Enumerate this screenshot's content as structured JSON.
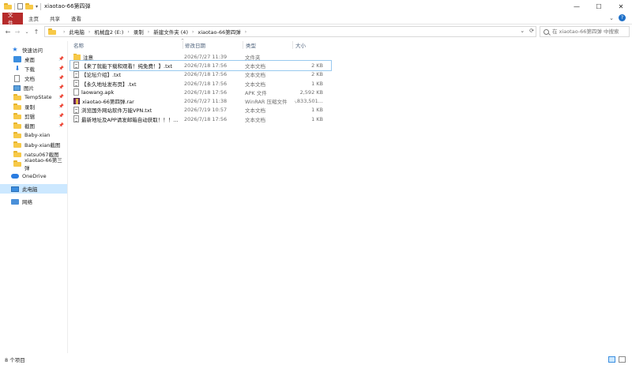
{
  "window": {
    "title": "xiaotao-66第四弹",
    "minimize_glyph": "—",
    "maximize_glyph": "☐",
    "close_glyph": "✕"
  },
  "ribbon": {
    "tabs": [
      "文件",
      "主页",
      "共享",
      "查看"
    ],
    "collapse_glyph": "⌄",
    "help_glyph": "?"
  },
  "navigation": {
    "back_glyph": "←",
    "forward_glyph": "→",
    "recent_glyph": "⌄",
    "up_glyph": "↑",
    "breadcrumb": [
      "此电脑",
      "机械盘2 (E:)",
      "录制",
      "新建文件夹 (4)",
      "xiaotao-66第四弹"
    ],
    "crumb_separator": "›",
    "dropdown_glyph": "⌄",
    "refresh_glyph": "⟳"
  },
  "search": {
    "placeholder": "在 xiaotao-66第四弹 中搜索"
  },
  "sidebar": {
    "items": [
      {
        "label": "快速访问",
        "icon": "star-icon",
        "pinned": false
      },
      {
        "label": "桌面",
        "icon": "desktop-icon",
        "pinned": true
      },
      {
        "label": "下载",
        "icon": "download-icon",
        "pinned": true
      },
      {
        "label": "文档",
        "icon": "document-icon",
        "pinned": true
      },
      {
        "label": "图片",
        "icon": "pictures-icon",
        "pinned": true
      },
      {
        "label": "TempState",
        "icon": "folder-icon",
        "pinned": true
      },
      {
        "label": "录制",
        "icon": "folder-icon",
        "pinned": true
      },
      {
        "label": "剪辑",
        "icon": "folder-icon",
        "pinned": true
      },
      {
        "label": "截图",
        "icon": "folder-icon",
        "pinned": true
      },
      {
        "label": "Baby-xian",
        "icon": "folder-icon",
        "pinned": false
      },
      {
        "label": "Baby-xian截图",
        "icon": "folder-icon",
        "pinned": false
      },
      {
        "label": "natsu067截图",
        "icon": "folder-icon",
        "pinned": false
      },
      {
        "label": "xiaotao-66第三弹",
        "icon": "folder-icon",
        "pinned": false
      },
      {
        "label": "OneDrive",
        "icon": "cloud-icon",
        "pinned": false
      },
      {
        "label": "此电脑",
        "icon": "computer-icon",
        "pinned": false,
        "selected": true
      },
      {
        "label": "网络",
        "icon": "network-icon",
        "pinned": false
      }
    ],
    "pin_glyph": "📌"
  },
  "columns": {
    "name": "名称",
    "date": "修改日期",
    "type": "类型",
    "size": "大小",
    "sort_glyph": "^"
  },
  "files": [
    {
      "name": "注意",
      "date": "2026/7/27 11:39",
      "type": "文件夹",
      "size": "",
      "icon": "folder"
    },
    {
      "name": "【来了就能下载和观看！纯免费！】.txt",
      "date": "2026/7/18 17:56",
      "type": "文本文档",
      "size": "2 KB",
      "icon": "txt",
      "focused": true
    },
    {
      "name": "【论坛介绍】.txt",
      "date": "2026/7/18 17:56",
      "type": "文本文档",
      "size": "2 KB",
      "icon": "txt"
    },
    {
      "name": "【永久地址发布页】.txt",
      "date": "2026/7/18 17:56",
      "type": "文本文档",
      "size": "1 KB",
      "icon": "txt"
    },
    {
      "name": "laowang.apk",
      "date": "2026/7/18 17:56",
      "type": "APK 文件",
      "size": "2,592 KB",
      "icon": "apk"
    },
    {
      "name": "xiaotao-66第四弹.rar",
      "date": "2026/7/27 11:38",
      "type": "WinRAR 压缩文件",
      "size": "6,833,501...",
      "icon": "rar"
    },
    {
      "name": "浏览国外网站软件万能VPN.txt",
      "date": "2026/7/19 10:57",
      "type": "文本文档",
      "size": "1 KB",
      "icon": "txt"
    },
    {
      "name": "最新地址及APP请发邮箱自动获取！！！...",
      "date": "2026/7/18 17:56",
      "type": "文本文档",
      "size": "1 KB",
      "icon": "txt"
    }
  ],
  "status": {
    "item_count": "8 个项目"
  }
}
